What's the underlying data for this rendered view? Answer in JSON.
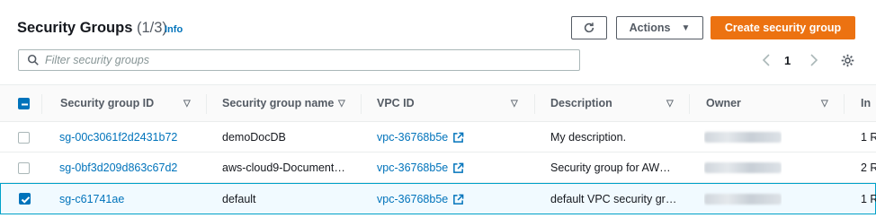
{
  "header": {
    "title": "Security Groups",
    "count": "(1/3)",
    "info_link": "Info"
  },
  "toolbar": {
    "refresh_icon": "refresh-icon",
    "actions_label": "Actions",
    "create_label": "Create security group",
    "create_color": "#ec7211"
  },
  "search": {
    "placeholder": "Filter security groups",
    "value": ""
  },
  "pagination": {
    "current_page": "1"
  },
  "table": {
    "columns": [
      "Security group ID",
      "Security group name",
      "VPC ID",
      "Description",
      "Owner",
      "In"
    ],
    "rows": [
      {
        "selected": false,
        "id": "sg-00c3061f2d2431b72",
        "name": "demoDocDB",
        "vpc": "vpc-36768b5e",
        "description": "My description.",
        "inbound": "1 R"
      },
      {
        "selected": false,
        "id": "sg-0bf3d209d863c67d2",
        "name": "aws-cloud9-Document…",
        "vpc": "vpc-36768b5e",
        "description": "Security group for AW…",
        "inbound": "2 R"
      },
      {
        "selected": true,
        "id": "sg-c61741ae",
        "name": "default",
        "vpc": "vpc-36768b5e",
        "description": "default VPC security gr…",
        "inbound": "1 R"
      }
    ]
  },
  "colors": {
    "link": "#0073bb",
    "selected_row_bg": "#f1faff",
    "selected_row_border": "#00a1c9"
  }
}
